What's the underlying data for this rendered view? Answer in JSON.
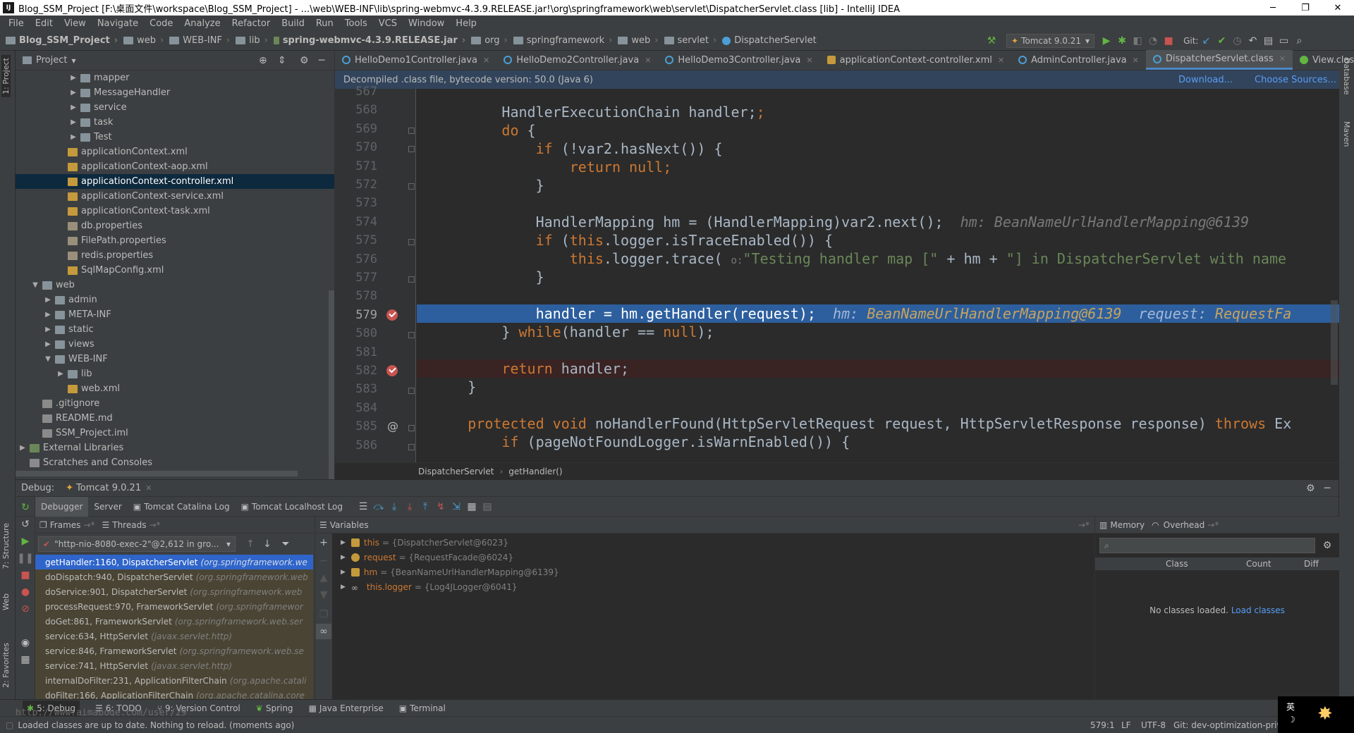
{
  "window": {
    "title": "Blog_SSM_Project [F:\\桌面文件\\workspace\\Blog_SSM_Project] - ...\\web\\WEB-INF\\lib\\spring-webmvc-4.3.9.RELEASE.jar!\\org\\springframework\\web\\servlet\\DispatcherServlet.class [lib] - IntelliJ IDEA",
    "minimize": "─",
    "maximize": "❐",
    "close": "✕"
  },
  "menu": [
    "File",
    "Edit",
    "View",
    "Navigate",
    "Code",
    "Analyze",
    "Refactor",
    "Build",
    "Run",
    "Tools",
    "VCS",
    "Window",
    "Help"
  ],
  "breadcrumbs": [
    "Blog_SSM_Project",
    "web",
    "WEB-INF",
    "lib",
    "spring-webmvc-4.3.9.RELEASE.jar",
    "org",
    "springframework",
    "web",
    "servlet",
    "DispatcherServlet"
  ],
  "toolbar": {
    "run_config": "Tomcat 9.0.21",
    "git_label": "Git:"
  },
  "sidestrips": {
    "left": [
      "1: Project",
      "7: Structure",
      "Web",
      "2: Favorites"
    ],
    "right": [
      "Database",
      "Maven"
    ]
  },
  "project": {
    "title": "Project",
    "tree": [
      {
        "label": "mapper",
        "type": "folder",
        "depth": 4,
        "arrow": "▶"
      },
      {
        "label": "MessageHandler",
        "type": "folder",
        "depth": 4,
        "arrow": "▶"
      },
      {
        "label": "service",
        "type": "folder",
        "depth": 4,
        "arrow": "▶"
      },
      {
        "label": "task",
        "type": "folder",
        "depth": 4,
        "arrow": "▶"
      },
      {
        "label": "Test",
        "type": "folder",
        "depth": 4,
        "arrow": "▶"
      },
      {
        "label": "applicationContext.xml",
        "type": "xml",
        "depth": 3,
        "arrow": ""
      },
      {
        "label": "applicationContext-aop.xml",
        "type": "xml",
        "depth": 3,
        "arrow": ""
      },
      {
        "label": "applicationContext-controller.xml",
        "type": "xml",
        "depth": 3,
        "arrow": "",
        "selected": true
      },
      {
        "label": "applicationContext-service.xml",
        "type": "xml",
        "depth": 3,
        "arrow": ""
      },
      {
        "label": "applicationContext-task.xml",
        "type": "xml",
        "depth": 3,
        "arrow": ""
      },
      {
        "label": "db.properties",
        "type": "prop",
        "depth": 3,
        "arrow": ""
      },
      {
        "label": "FilePath.properties",
        "type": "prop",
        "depth": 3,
        "arrow": ""
      },
      {
        "label": "redis.properties",
        "type": "prop",
        "depth": 3,
        "arrow": ""
      },
      {
        "label": "SqlMapConfig.xml",
        "type": "xml",
        "depth": 3,
        "arrow": ""
      },
      {
        "label": "web",
        "type": "folder",
        "depth": 1,
        "arrow": "▼"
      },
      {
        "label": "admin",
        "type": "folder",
        "depth": 2,
        "arrow": "▶"
      },
      {
        "label": "META-INF",
        "type": "folder",
        "depth": 2,
        "arrow": "▶"
      },
      {
        "label": "static",
        "type": "folder",
        "depth": 2,
        "arrow": "▶"
      },
      {
        "label": "views",
        "type": "folder",
        "depth": 2,
        "arrow": "▶"
      },
      {
        "label": "WEB-INF",
        "type": "folder",
        "depth": 2,
        "arrow": "▼"
      },
      {
        "label": "lib",
        "type": "folder",
        "depth": 3,
        "arrow": "▶"
      },
      {
        "label": "web.xml",
        "type": "xml",
        "depth": 3,
        "arrow": ""
      },
      {
        "label": ".gitignore",
        "type": "file",
        "depth": 1,
        "arrow": ""
      },
      {
        "label": "README.md",
        "type": "file",
        "depth": 1,
        "arrow": ""
      },
      {
        "label": "SSM_Project.iml",
        "type": "file",
        "depth": 1,
        "arrow": ""
      },
      {
        "label": "External Libraries",
        "type": "lib",
        "depth": 0,
        "arrow": "▶"
      },
      {
        "label": "Scratches and Consoles",
        "type": "file",
        "depth": 0,
        "arrow": ""
      }
    ]
  },
  "editor": {
    "tabs": [
      {
        "label": "HelloDemo1Controller.java",
        "kind": "java"
      },
      {
        "label": "HelloDemo2Controller.java",
        "kind": "java"
      },
      {
        "label": "HelloDemo3Controller.java",
        "kind": "java"
      },
      {
        "label": "applicationContext-controller.xml",
        "kind": "xml"
      },
      {
        "label": "AdminController.java",
        "kind": "java"
      },
      {
        "label": "DispatcherServlet.class",
        "kind": "java",
        "active": true
      },
      {
        "label": "View.class",
        "kind": "view"
      }
    ],
    "decompiled_note": "Decompiled .class file, bytecode version: 50.0 (Java 6)",
    "download_link": "Download...",
    "sources_link": "Choose Sources...",
    "line_numbers": [
      "567",
      "568",
      "569",
      "570",
      "571",
      "572",
      "573",
      "574",
      "575",
      "576",
      "577",
      "578",
      "579",
      "580",
      "581",
      "582",
      "583",
      "584",
      "585",
      "586"
    ],
    "current_line": "579",
    "breadcrumb": [
      "DispatcherServlet",
      "getHandler()"
    ],
    "code": {
      "l568": "HandlerExecutionChain handler;",
      "l569_kw": "do",
      "l569": " {",
      "l570_kw": "if",
      "l570": " (!var2.hasNext()) {",
      "l571_kw": "return null",
      "l571": ";",
      "l572": "}",
      "l574": "HandlerMapping hm = (HandlerMapping)var2.next();",
      "l574_hint": "hm: BeanNameUrlHandlerMapping@6139",
      "l575_kw": "if",
      "l575": " (",
      "l575_this": "this",
      "l575b": ".logger.isTraceEnabled()) {",
      "l576_this": "this",
      "l576": ".logger.trace( ",
      "l576_param": "o:",
      "l576_str1": "\"Testing handler map [\"",
      "l576_mid": " + hm + ",
      "l576_str2": "\"] in DispatcherServlet with name",
      "l577": "}",
      "l579": "handler = hm.getHandler(request);",
      "l579_hintk1": "hm:",
      "l579_hintv1": "BeanNameUrlHandlerMapping@6139",
      "l579_hintk2": "request:",
      "l579_hintv2": "RequestFa",
      "l580a": "} ",
      "l580_kw": "while",
      "l580b": "(handler == ",
      "l580_null": "null",
      "l580c": ");",
      "l582_kw": "return",
      "l582": " handler;",
      "l583": "}",
      "l585_kw": "protected void",
      "l585": " noHandlerFound(HttpServletRequest request, HttpServletResponse response) ",
      "l585_kw2": "throws",
      "l585c": " Ex",
      "l586_kw": "if",
      "l586": " (pageNotFoundLogger.isWarnEnabled()) {"
    }
  },
  "debug": {
    "label": "Debug:",
    "session": "Tomcat 9.0.21",
    "tabs": [
      "Debugger",
      "Server",
      "Tomcat Catalina Log",
      "Tomcat Localhost Log"
    ],
    "frames_label": "Frames",
    "threads_label": "Threads",
    "thread_select": "\"http-nio-8080-exec-2\"@2,612 in gro...",
    "frames": [
      {
        "method": "getHandler:1160, DispatcherServlet",
        "pkg": "(org.springframework.we",
        "selected": true
      },
      {
        "method": "doDispatch:940, DispatcherServlet",
        "pkg": "(org.springframework.web"
      },
      {
        "method": "doService:901, DispatcherServlet",
        "pkg": "(org.springframework.web"
      },
      {
        "method": "processRequest:970, FrameworkServlet",
        "pkg": "(org.springframewor"
      },
      {
        "method": "doGet:861, FrameworkServlet",
        "pkg": "(org.springframework.web.ser"
      },
      {
        "method": "service:634, HttpServlet",
        "pkg": "(javax.servlet.http)"
      },
      {
        "method": "service:846, FrameworkServlet",
        "pkg": "(org.springframework.web.se"
      },
      {
        "method": "service:741, HttpServlet",
        "pkg": "(javax.servlet.http)"
      },
      {
        "method": "internalDoFilter:231, ApplicationFilterChain",
        "pkg": "(org.apache.catali"
      },
      {
        "method": "doFilter:166, ApplicationFilterChain",
        "pkg": "(org.apache.catalina.core"
      }
    ],
    "variables_label": "Variables",
    "variables": [
      {
        "name": "this",
        "value": "= {DispatcherServlet@6023}"
      },
      {
        "name": "request",
        "value": "= {RequestFacade@6024}"
      },
      {
        "name": "hm",
        "value": "= {BeanNameUrlHandlerMapping@6139}"
      },
      {
        "name": "this.logger",
        "value": "= {Log4JLogger@6041}"
      }
    ],
    "memory_label": "Memory",
    "overhead_label": "Overhead",
    "memory_columns": [
      "Class",
      "Count",
      "Diff"
    ],
    "no_classes": "No classes loaded.",
    "load_classes": "Load classes"
  },
  "bottom_tools": [
    "5: Debug",
    "6: TODO",
    "9: Version Control",
    "Spring",
    "Java Enterprise",
    "Terminal"
  ],
  "watermark": "http://www.aimaboge.com/user/29",
  "status": {
    "message": "Loaded classes are up to date. Nothing to reload. (moments ago)",
    "position": "579:1",
    "line_sep": "LF",
    "encoding": "UTF-8",
    "git": "Git: dev-optimization-priv"
  },
  "ime": {
    "label": "英"
  },
  "colors": {
    "selection": "#2f65ca",
    "exec_line": "#2d5f9e",
    "breakpoint": "#c75450",
    "keyword": "#cc7832",
    "string": "#6a8759",
    "link": "#589df6"
  }
}
